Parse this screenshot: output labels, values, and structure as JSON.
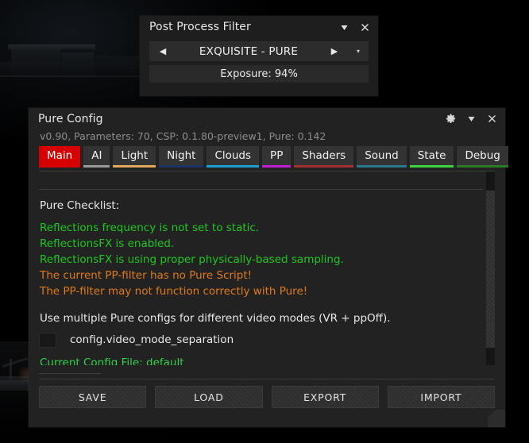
{
  "background": {
    "scene_description": "dark night racing-sim scene"
  },
  "pp_panel": {
    "title": "Post Process Filter",
    "icons": {
      "collapse": "chevron-down-icon",
      "close": "close-icon"
    },
    "prev_label": "◀",
    "filter_name": "EXQUISITE - PURE",
    "next_label": "▶",
    "dropdown_label": "▾",
    "exposure": "Exposure: 94%"
  },
  "config_window": {
    "title": "Pure Config",
    "icons": {
      "settings": "gear-icon",
      "collapse": "chevron-down-icon",
      "close": "close-icon"
    },
    "subtitle": "v0.90, Parameters: 70, CSP: 0.1.80-preview1, Pure: 0.142",
    "tabs": [
      {
        "label": "Main",
        "color": "#d70000",
        "active": true
      },
      {
        "label": "AI",
        "color": "#9a9a9a",
        "active": false
      },
      {
        "label": "Light",
        "color": "#e0a85a",
        "active": false
      },
      {
        "label": "Night",
        "color": "#1b3560",
        "active": false
      },
      {
        "label": "Clouds",
        "color": "#1c9fd4",
        "active": false
      },
      {
        "label": "PP",
        "color": "#c21fd4",
        "active": false
      },
      {
        "label": "Shaders",
        "color": "#a33030",
        "active": false
      },
      {
        "label": "Sound",
        "color": "#29788c",
        "active": false
      },
      {
        "label": "State",
        "color": "#3fd43f",
        "active": false
      },
      {
        "label": "Debug",
        "color": "#2a7a2a",
        "active": false
      }
    ],
    "checklist": {
      "heading": "Pure Checklist:",
      "items": [
        {
          "text": "Reflections frequency is not set to static.",
          "status": "ok",
          "color": "#1ec81e"
        },
        {
          "text": "ReflectionsFX is enabled.",
          "status": "ok",
          "color": "#1ec81e"
        },
        {
          "text": "ReflectionsFX is using proper physically-based sampling.",
          "status": "ok",
          "color": "#1ec81e"
        },
        {
          "text": "The current PP-filter has no Pure Script!",
          "status": "warn",
          "color": "#e07b18"
        },
        {
          "text": "The PP-filter may not function correctly with Pure!",
          "status": "warn",
          "color": "#e07b18"
        }
      ]
    },
    "video_mode": {
      "description": "Use multiple Pure configs for different video modes (VR + ppOff).",
      "checkbox_label": "config.video_mode_separation",
      "checked": false
    },
    "current_config": "Current Config File: default",
    "buttons": [
      {
        "label": "SAVE"
      },
      {
        "label": "LOAD"
      },
      {
        "label": "EXPORT"
      },
      {
        "label": "IMPORT"
      }
    ]
  }
}
